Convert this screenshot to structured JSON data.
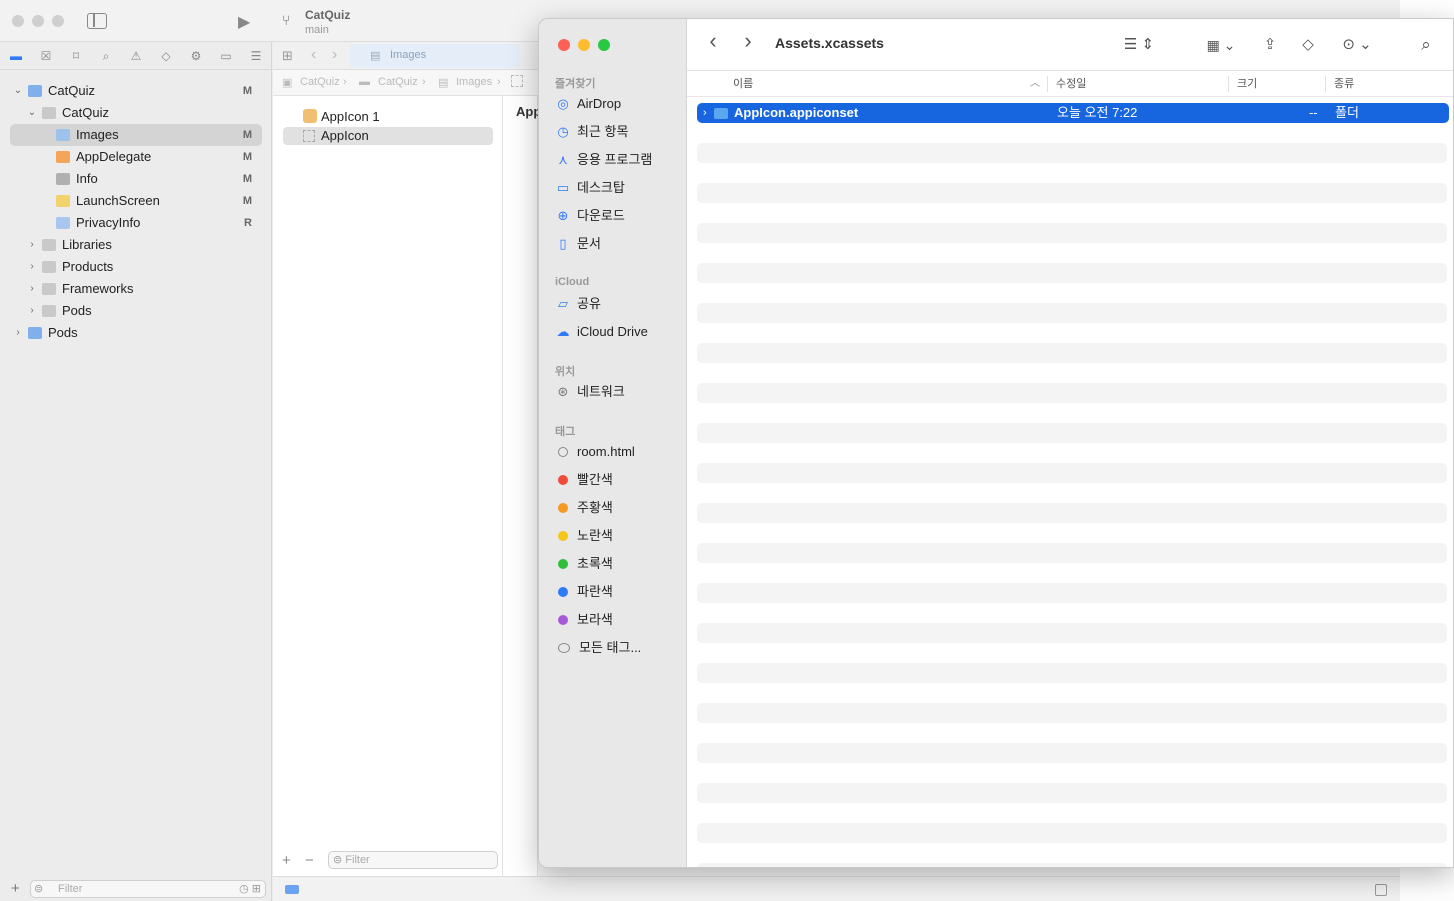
{
  "xcode": {
    "project_name": "CatQuiz",
    "branch": "main",
    "tab_label": "Images",
    "jump_bar": [
      "CatQuiz",
      "CatQuiz",
      "Images"
    ],
    "editor_partial_label": "App",
    "navigator": {
      "items": [
        {
          "label": "CatQuiz",
          "badge": "M",
          "level": 0,
          "expanded": true,
          "kind": "project"
        },
        {
          "label": "CatQuiz",
          "badge": "",
          "level": 1,
          "expanded": true,
          "kind": "folder"
        },
        {
          "label": "Images",
          "badge": "M",
          "level": 2,
          "selected": true,
          "kind": "assets"
        },
        {
          "label": "AppDelegate",
          "badge": "M",
          "level": 2,
          "kind": "swift"
        },
        {
          "label": "Info",
          "badge": "M",
          "level": 2,
          "kind": "plist"
        },
        {
          "label": "LaunchScreen",
          "badge": "M",
          "level": 2,
          "kind": "storyboard"
        },
        {
          "label": "PrivacyInfo",
          "badge": "R",
          "level": 2,
          "kind": "privacy"
        },
        {
          "label": "Libraries",
          "badge": "",
          "level": 1,
          "collapsed": true,
          "kind": "folder"
        },
        {
          "label": "Products",
          "badge": "",
          "level": 1,
          "collapsed": true,
          "kind": "folder"
        },
        {
          "label": "Frameworks",
          "badge": "",
          "level": 1,
          "collapsed": true,
          "kind": "folder"
        },
        {
          "label": "Pods",
          "badge": "",
          "level": 1,
          "collapsed": true,
          "kind": "folder"
        },
        {
          "label": "Pods",
          "badge": "",
          "level": 0,
          "collapsed": true,
          "kind": "project"
        }
      ],
      "filter_placeholder": "Filter"
    },
    "asset_list": {
      "items": [
        "AppIcon 1",
        "AppIcon"
      ],
      "filter_placeholder": "Filter"
    }
  },
  "finder": {
    "title": "Assets.xcassets",
    "sidebar": {
      "favorites_title": "즐겨찾기",
      "favorites": [
        {
          "label": "AirDrop",
          "icon": "airdrop-icon"
        },
        {
          "label": "최근 항목",
          "icon": "clock-icon"
        },
        {
          "label": "응용 프로그램",
          "icon": "apps-icon"
        },
        {
          "label": "데스크탑",
          "icon": "desktop-icon"
        },
        {
          "label": "다운로드",
          "icon": "download-icon"
        },
        {
          "label": "문서",
          "icon": "document-icon"
        }
      ],
      "icloud_title": "iCloud",
      "icloud": [
        {
          "label": "공유",
          "icon": "shared-folder-icon"
        },
        {
          "label": "iCloud Drive",
          "icon": "cloud-icon"
        }
      ],
      "locations_title": "위치",
      "locations": [
        {
          "label": "네트워크",
          "icon": "globe-icon"
        }
      ],
      "tags_title": "태그",
      "tags": [
        {
          "label": "room.html",
          "color": "none"
        },
        {
          "label": "빨간색",
          "color": "#f04a3a"
        },
        {
          "label": "주황색",
          "color": "#f59a23"
        },
        {
          "label": "노란색",
          "color": "#f5c518"
        },
        {
          "label": "초록색",
          "color": "#2fbf3b"
        },
        {
          "label": "파란색",
          "color": "#2f7bf5"
        },
        {
          "label": "보라색",
          "color": "#a55bd8"
        },
        {
          "label": "모든 태그...",
          "color": "all"
        }
      ]
    },
    "columns": {
      "name": "이름",
      "modified": "수정일",
      "size": "크기",
      "kind": "종류"
    },
    "rows": [
      {
        "name": "AppIcon.appiconset",
        "modified": "오늘 오전 7:22",
        "size": "--",
        "kind": "폴더",
        "selected": true
      }
    ]
  },
  "colors": {
    "accent": "#1766e0",
    "folder_blue": "#5aa6f0"
  }
}
